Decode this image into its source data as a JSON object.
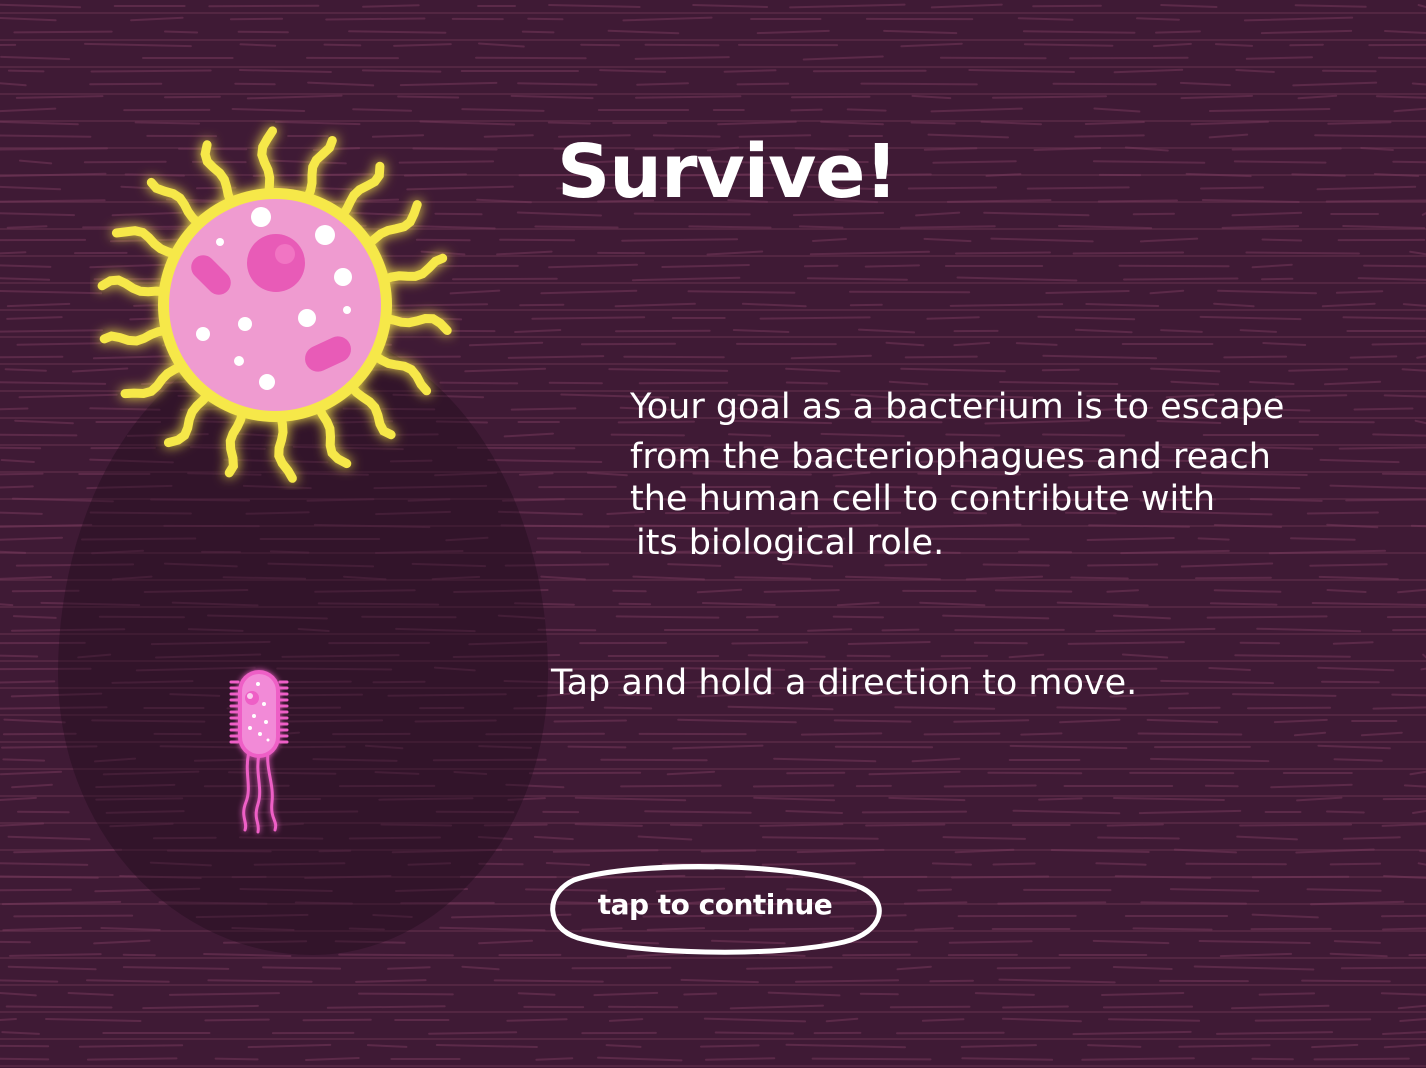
{
  "screen": {
    "title": "Survive!",
    "goal_lines": [
      "Your goal as a bacterium is to escape",
      "from the bacteriophagues and reach",
      "the human cell to contribute with",
      "its biological role."
    ],
    "hint": "Tap and hold a direction to move.",
    "continue_label": "tap to continue"
  },
  "icons": {
    "cell": "human-cell-icon",
    "bacterium": "bacterium-player-icon"
  },
  "colors": {
    "background": "#3f1a35",
    "cell_membrane": "#f6e84a",
    "cell_body": "#ef9bd0",
    "organelle": "#e85bb7",
    "bacterium": "#ee5fc6",
    "text": "#ffffff"
  }
}
